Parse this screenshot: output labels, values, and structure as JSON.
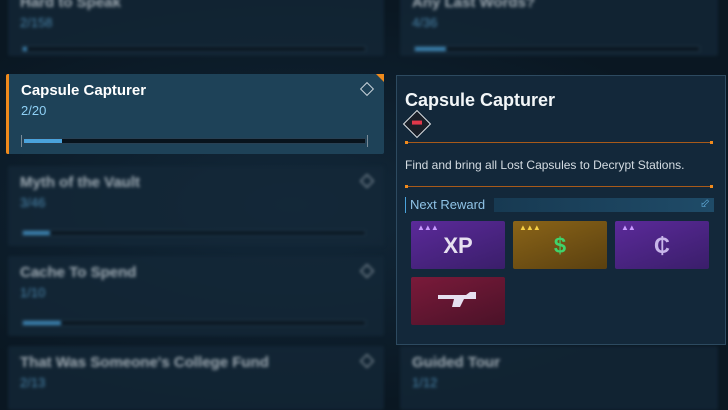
{
  "list": {
    "cards": [
      {
        "title": "Hard to Speak",
        "progress": "2/158",
        "fill": 0.013
      },
      {
        "title": "Any Last Words?",
        "progress": "4/36",
        "fill": 0.11
      },
      {
        "title": "Capsule Capturer",
        "progress": "2/20",
        "fill": 0.1
      },
      {
        "title": "Myth of the Vault",
        "progress": "3/46",
        "fill": 0.065
      },
      {
        "title": "Cache To Spend",
        "progress": "1/10",
        "fill": 0.1
      },
      {
        "title": "That Was Someone's College Fund",
        "progress": "2/13",
        "fill": 0.15
      },
      {
        "title": "Guided Tour",
        "progress": "1/12",
        "fill": 0.08
      }
    ]
  },
  "detail": {
    "title": "Capsule Capturer",
    "description": "Find and bring all Lost Capsules to Decrypt Stations.",
    "next_reward_label": "Next Reward",
    "rewards": [
      {
        "icon": "xp-icon",
        "glyph": "XP"
      },
      {
        "icon": "cash-icon",
        "glyph": "$"
      },
      {
        "icon": "eridium-icon",
        "glyph": "₵"
      },
      {
        "icon": "weapon-icon",
        "glyph": "🔫"
      }
    ]
  },
  "colors": {
    "accent": "#f08a1c",
    "progress": "#4aa3dc",
    "rarity_purple": "#5b2a9a",
    "rarity_gold": "#8a6418"
  }
}
